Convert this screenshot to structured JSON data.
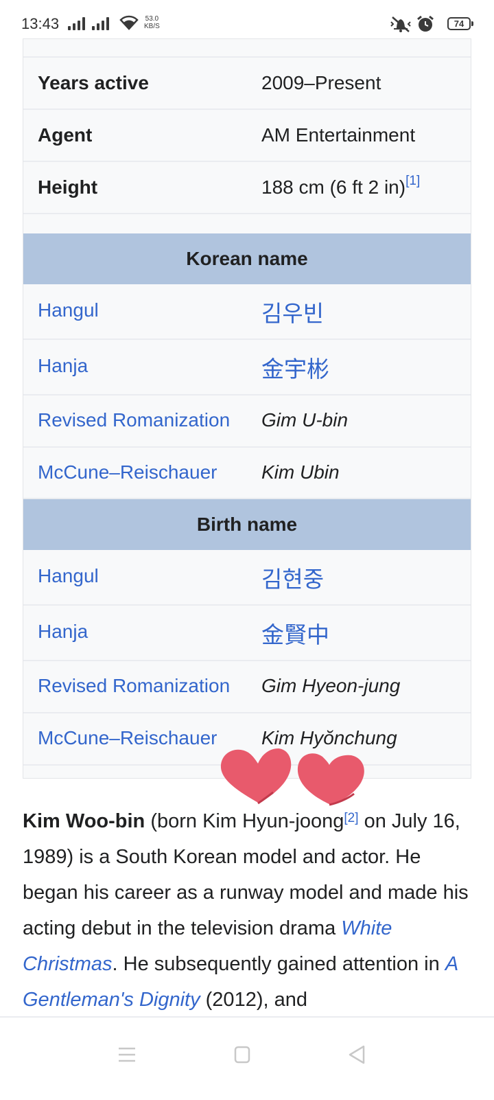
{
  "status_bar": {
    "time": "13:43",
    "net_speed_value": "53.0",
    "net_speed_unit": "KB/S",
    "battery": "74",
    "icons": [
      "signal-icon",
      "signal-icon",
      "wifi-icon",
      "vibrate-off-icon",
      "alarm-icon",
      "battery-icon"
    ]
  },
  "infobox": {
    "rows_top": [
      {
        "label": "Years active",
        "value": "2009–Present",
        "ref": ""
      },
      {
        "label": "Agent",
        "value": "AM Entertainment",
        "ref": ""
      },
      {
        "label": "Height",
        "value": "188 cm (6 ft 2 in)",
        "ref": "[1]"
      }
    ],
    "korean_name": {
      "header": "Korean name",
      "hangul_label": "Hangul",
      "hangul_value": "김우빈",
      "hanja_label": "Hanja",
      "hanja_value": "金宇彬",
      "rr_label": "Revised Romanization",
      "rr_value": "Gim U-bin",
      "mr_label": "McCune–Reischauer",
      "mr_value": "Kim Ubin"
    },
    "birth_name": {
      "header": "Birth name",
      "hangul_label": "Hangul",
      "hangul_value": "김현중",
      "hanja_label": "Hanja",
      "hanja_value": "金賢中",
      "rr_label": "Revised Romanization",
      "rr_value": "Gim Hyeon-jung",
      "mr_label": "McCune–Reischauer",
      "mr_value": "Kim Hyŏnchung"
    }
  },
  "article": {
    "name_bold": "Kim Woo-bin",
    "text1": " (born Kim Hyun-joong",
    "ref2": "[2]",
    "text2": " on July 16, 1989) is a South Korean model and actor. He began his career as a runway model and made his acting debut in the television drama ",
    "link1": "White Christmas",
    "text3": ". He subsequently gained attention in ",
    "link2": "A Gentleman's Dignity",
    "text4": " (2012), and"
  },
  "colors": {
    "link": "#3366cc",
    "header_bg": "#b0c4de",
    "infobox_bg": "#f8f9fa",
    "heart": "#e85a6c"
  },
  "navbar": {
    "icons": [
      "menu-icon",
      "home-square-icon",
      "back-triangle-icon"
    ]
  }
}
